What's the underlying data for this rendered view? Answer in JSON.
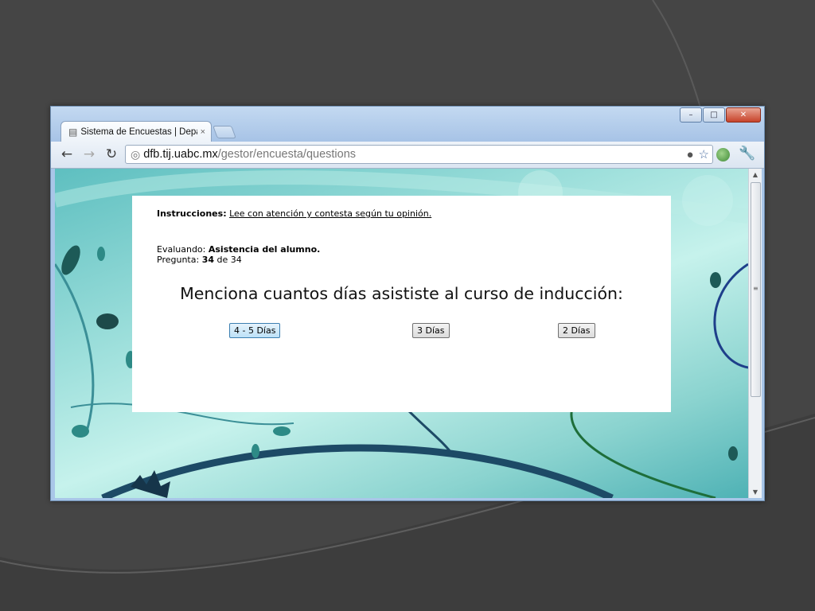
{
  "browser": {
    "tab": {
      "title": "Sistema de Encuestas | Depa",
      "close_glyph": "×"
    },
    "address": {
      "host": "dfb.tij.uabc.mx",
      "path": "/gestor/encuesta/questions"
    },
    "window_controls": {
      "minimize": "–",
      "maximize": "□",
      "close": "✕"
    }
  },
  "survey": {
    "instructions_label": "Instrucciones:",
    "instructions_text": "Lee con atención y contesta según tu opinión.",
    "evaluating_label": "Evaluando:",
    "evaluating_value": "Asistencia del alumno.",
    "question_label": "Pregunta:",
    "question_current": "34",
    "question_of": "de",
    "question_total": "34",
    "question_text": "Menciona cuantos días asististe al curso de inducción:",
    "answers": [
      "4 - 5 Días",
      "3 Días",
      "2 Días"
    ]
  },
  "icons": {
    "back": "arrow-left-icon",
    "forward": "arrow-right-icon",
    "reload": "reload-icon",
    "site": "globe-icon",
    "star": "star-icon",
    "wrench": "wrench-icon"
  },
  "colors": {
    "slide_background": "#454545",
    "page_background": "#8fd6d1",
    "card": "#ffffff",
    "focused_button": "#bde1f7"
  }
}
